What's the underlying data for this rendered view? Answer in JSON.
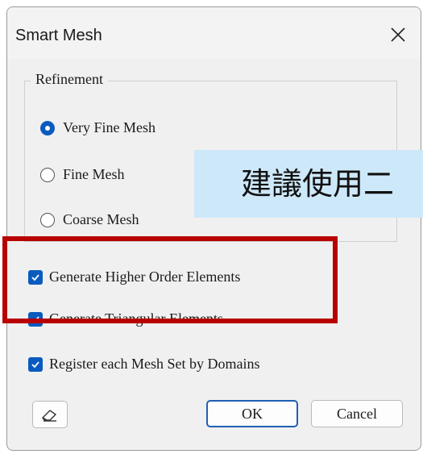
{
  "dialog": {
    "title": "Smart Mesh",
    "close_icon": "close-icon",
    "refinement": {
      "legend": "Refinement",
      "options": [
        {
          "label": "Very Fine Mesh",
          "selected": true
        },
        {
          "label": "Fine Mesh",
          "selected": false
        },
        {
          "label": "Coarse Mesh",
          "selected": false
        }
      ]
    },
    "checkboxes": [
      {
        "label": "Generate Higher Order Elements",
        "checked": true
      },
      {
        "label": "Generate Triangular Elements",
        "checked": true
      },
      {
        "label": "Register each Mesh Set by Domains",
        "checked": true
      }
    ],
    "buttons": {
      "eraser_icon": "eraser-icon",
      "ok": "OK",
      "cancel": "Cancel"
    }
  },
  "annotation": {
    "text": "建議使用二",
    "highlight_color": "#b80000",
    "background": "#cde8f9"
  },
  "colors": {
    "accent": "#0a5bbd"
  }
}
